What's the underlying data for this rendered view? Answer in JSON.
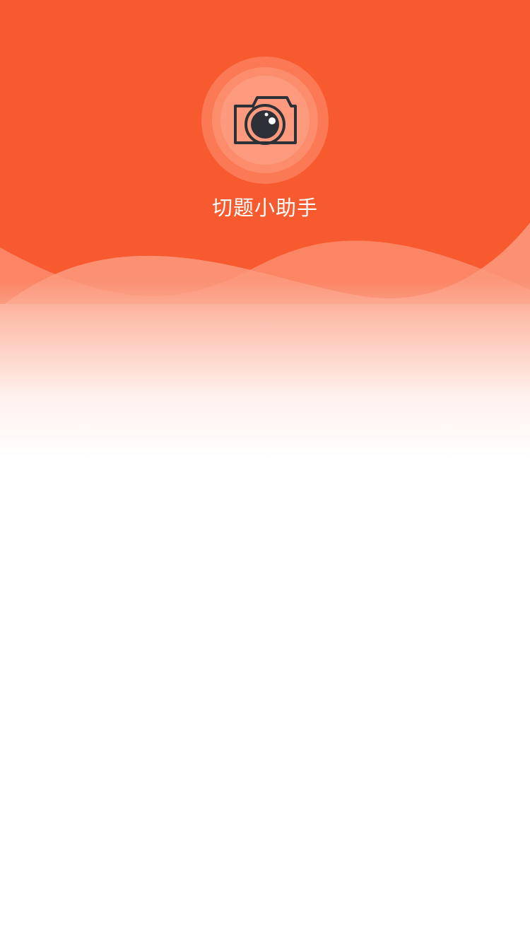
{
  "splash": {
    "app_name": "切题小助手",
    "logo_icon": "camera-icon"
  },
  "colors": {
    "brand": "#f75a2f",
    "wave_light": "#fb8a6a",
    "logo_ring_outer": "#fb7a55",
    "logo_ring_mid": "#fc8d6c",
    "logo_ring_inner": "#fd9a7d",
    "camera_stroke": "#2e3038",
    "background": "#ffffff"
  }
}
